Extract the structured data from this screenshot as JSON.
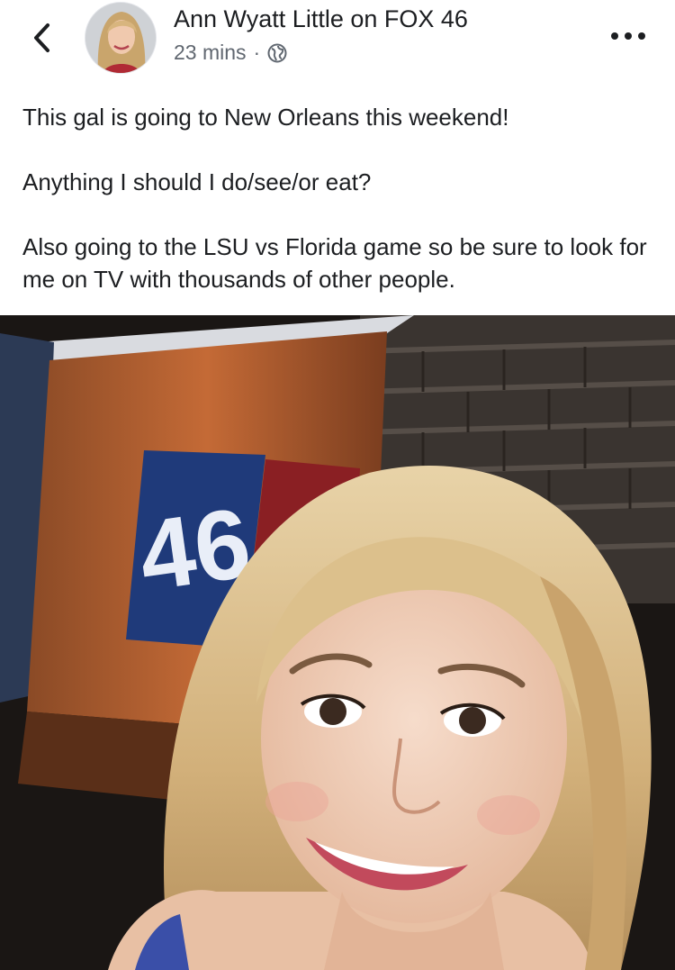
{
  "header": {
    "back_icon": "chevron-left-icon",
    "author_name": "Ann Wyatt Little on FOX 46",
    "timestamp": "23 mins",
    "separator": "·",
    "privacy_icon": "globe-icon",
    "more_icon": "more-horizontal-icon"
  },
  "post": {
    "paragraphs": [
      "This gal is going to New Orleans this weekend!",
      "Anything I should I do/see/or eat?",
      "Also going to the LSU vs Florida game so be sure to look for me on TV with thousands of other people."
    ]
  },
  "photo": {
    "sign_text": "46"
  },
  "colors": {
    "text_primary": "#1c1e21",
    "text_secondary": "#606770",
    "background": "#ffffff"
  }
}
